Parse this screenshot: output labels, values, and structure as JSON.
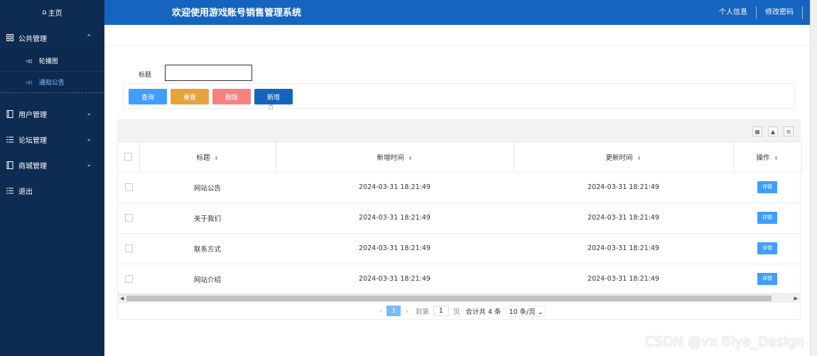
{
  "sidebar": {
    "home": "主页",
    "menus": [
      {
        "label": "公共管理",
        "icon": "grid-icon",
        "expanded": true,
        "items": [
          {
            "label": "轮播图"
          },
          {
            "label": "通知公告"
          }
        ]
      },
      {
        "label": "用户管理",
        "icon": "book-icon"
      },
      {
        "label": "论坛管理",
        "icon": "list-icon"
      },
      {
        "label": "商城管理",
        "icon": "book-icon"
      },
      {
        "label": "退出",
        "icon": "list-icon"
      }
    ],
    "active_item": "通知公告"
  },
  "header": {
    "title": "欢迎使用游戏账号销售管理系统",
    "links": [
      "个人信息",
      "修改密码"
    ]
  },
  "search": {
    "label": "标题",
    "value": ""
  },
  "buttons": {
    "query": "查询",
    "reset": "重置",
    "delete": "删除",
    "add": "新增"
  },
  "table": {
    "columns": [
      "标题",
      "新增时间",
      "更新时间",
      "操作"
    ],
    "rows": [
      {
        "title": "网站公告",
        "created": "2024-03-31 18:21:49",
        "updated": "2024-03-31 18:21:49",
        "action": "详情"
      },
      {
        "title": "关于我们",
        "created": "2024-03-31 18:21:49",
        "updated": "2024-03-31 18:21:49",
        "action": "详情"
      },
      {
        "title": "联系方式",
        "created": "2024-03-31 18:21:49",
        "updated": "2024-03-31 18:21:49",
        "action": "详情"
      },
      {
        "title": "网站介绍",
        "created": "2024-03-31 18:21:49",
        "updated": "2024-03-31 18:21:49",
        "action": "详情"
      }
    ]
  },
  "pager": {
    "current": "1",
    "goto_label": "到第",
    "goto_value": "1",
    "page_label": "页",
    "total": "合计共 4 条",
    "page_size": "10 条/页"
  },
  "watermark": "CSDN @vx  Biye_Design",
  "colors": {
    "sidebar": "#0e2c52",
    "header": "#1565c0",
    "primary": "#409eff",
    "warning": "#e6a23c",
    "danger": "#f56c6c"
  }
}
